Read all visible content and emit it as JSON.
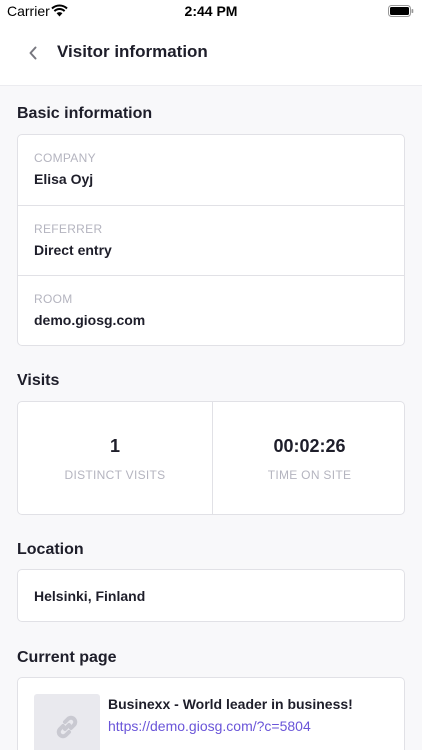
{
  "status_bar": {
    "carrier": "Carrier",
    "time": "2:44 PM"
  },
  "nav": {
    "title": "Visitor information",
    "back_icon": "chevron-left-icon"
  },
  "basic_information": {
    "title": "Basic information",
    "rows": [
      {
        "label": "COMPANY",
        "value": "Elisa Oyj"
      },
      {
        "label": "REFERRER",
        "value": "Direct entry"
      },
      {
        "label": "ROOM",
        "value": "demo.giosg.com"
      }
    ]
  },
  "visits": {
    "title": "Visits",
    "distinct_visits": {
      "value": "1",
      "label": "DISTINCT VISITS"
    },
    "time_on_site": {
      "value": "00:02:26",
      "label": "TIME ON SITE"
    }
  },
  "location": {
    "title": "Location",
    "value": "Helsinki, Finland"
  },
  "current_page": {
    "title": "Current page",
    "page_title": "Businexx - World leader in business!",
    "url": "https://demo.giosg.com/?c=5804",
    "thumbnail_icon": "link-icon"
  },
  "colors": {
    "link": "#6a55d9",
    "muted": "#b4b4bf",
    "border": "#e1e1e6"
  }
}
